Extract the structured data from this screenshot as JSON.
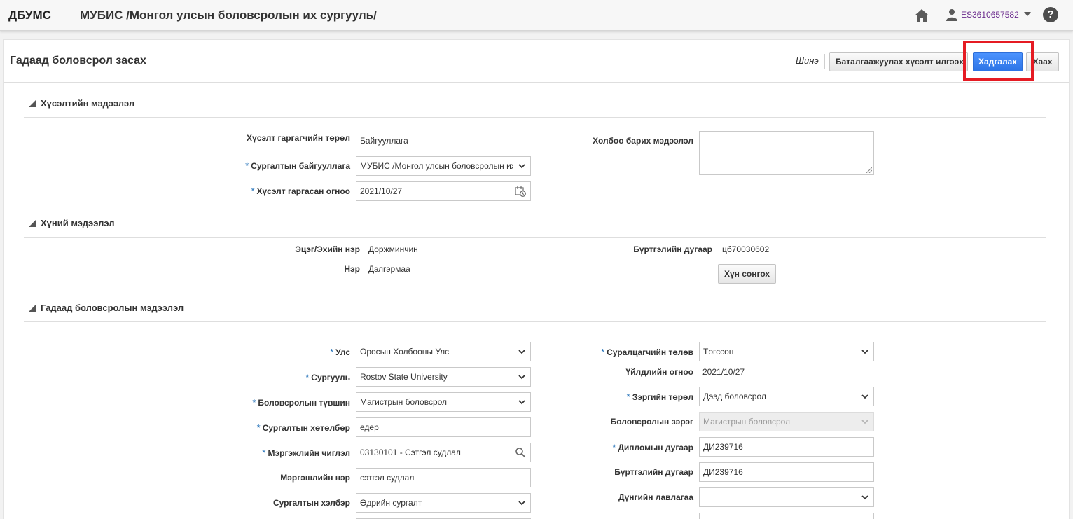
{
  "header": {
    "brand": "ДБУМС",
    "app_title": "МУБИС /Монгол улсын боловсролын их сургууль/",
    "user": "ES3610657582",
    "help": "?"
  },
  "page": {
    "title": "Гадаад боловсрол засах",
    "toolbar": {
      "status": "Шинэ",
      "submit_label": "Баталгаажуулах хүсэлт илгээх",
      "save_label": "Хадгалах",
      "close_label": "Хаах"
    }
  },
  "request": {
    "section_title": "Хүсэлтийн мэдээлэл",
    "applicant_type_label": "Хүсэлт гаргагчийн төрөл",
    "applicant_type": "Байгууллага",
    "org_label": "Сургалтын байгууллага",
    "org": "МУБИС /Монгол улсын боловсролын их",
    "date_label": "Хүсэлт гаргасан огноо",
    "date": "2021/10/27",
    "contact_label": "Холбоо барих мэдээлэл",
    "contact": ""
  },
  "person": {
    "section_title": "Хүний мэдээлэл",
    "parent_name_label": "Эцэг/Эхийн нэр",
    "parent_name": "Доржминчин",
    "name_label": "Нэр",
    "name": "Дэлгэрмаа",
    "reg_label": "Бүртгэлийн дугаар",
    "reg": "цб70030602",
    "select_label": "Хүн сонгох"
  },
  "education": {
    "section_title": "Гадаад боловсролын мэдээлэл",
    "country_label": "Улс",
    "country": "Оросын Холбооны Улс",
    "school_label": "Сургууль",
    "school": "Rostov State University",
    "level_label": "Боловсролын түвшин",
    "level": "Магистрын боловсрол",
    "program_label": "Сургалтын хөтөлбөр",
    "program": "едер",
    "field_label": "Мэргэжлийн чиглэл",
    "field": "03130101 - Сэтгэл судлал",
    "profession_label": "Мэргэшлийн нэр",
    "profession": "сэтгэл судлал",
    "form_label": "Сургалтын хэлбэр",
    "form": "Өдрийн сургалт",
    "status_label": "Суралцагчийн төлөв",
    "status": "Төгссөн",
    "action_date_label": "Үйлдлийн огноо",
    "action_date": "2021/10/27",
    "degree_type_label": "Зэргийн төрөл",
    "degree_type": "Дээд боловсрол",
    "edu_degree_label": "Боловсролын зэрэг",
    "edu_degree": "Магистрын боловсрол",
    "diploma_label": "Дипломын дугаар",
    "diploma": "ДИ239716",
    "reg_no_label": "Бүртгэлийн дугаар",
    "reg_no": "ДИ239716",
    "grade_ref_label": "Дүнгийн лавлагаа",
    "grade_ref": ""
  },
  "colors": {
    "primary": "#3b82f6",
    "required": "#1f6fb8",
    "highlight": "#e51b23",
    "user": "#6a2a8c"
  }
}
